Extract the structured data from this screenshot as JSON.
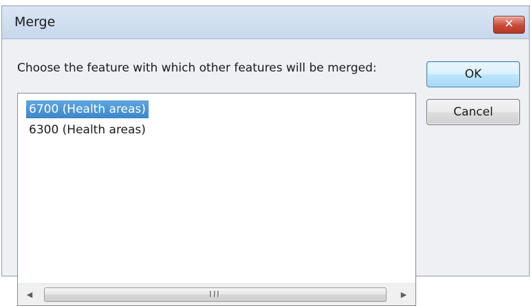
{
  "window": {
    "title": "Merge",
    "close_label": "✕"
  },
  "dialog": {
    "prompt": "Choose the feature with which other features will be merged:",
    "ok_label": "OK",
    "cancel_label": "Cancel"
  },
  "list": {
    "items": [
      {
        "label": "6700 (Health areas)",
        "selected": true
      },
      {
        "label": "6300 (Health areas)",
        "selected": false
      }
    ]
  },
  "scrollbar": {
    "left_arrow": "◀",
    "right_arrow": "▶"
  },
  "colors": {
    "selection": "#3d86c9",
    "close_button": "#c8493a",
    "default_button_border": "#3c7fb1"
  }
}
